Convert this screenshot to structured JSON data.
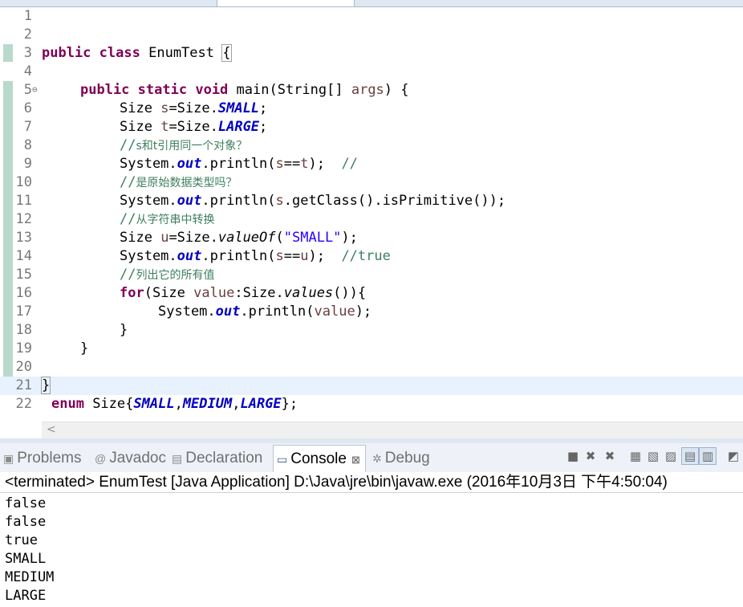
{
  "editor": {
    "line_numbers": [
      "1",
      "2",
      "3",
      "4",
      "5",
      "6",
      "7",
      "8",
      "9",
      "10",
      "11",
      "12",
      "13",
      "14",
      "15",
      "16",
      "17",
      "18",
      "19",
      "20",
      "21",
      "22"
    ],
    "lines": {
      "l3": {
        "kw1": "public",
        "kw2": "class",
        "name": "EnumTest",
        "brace": "{"
      },
      "l5": {
        "kw1": "public",
        "kw2": "static",
        "kw3": "void",
        "m": "main(String[] ",
        "p": "args",
        "end": ") {"
      },
      "l6": {
        "a": "Size ",
        "v": "s",
        "b": "=Size.",
        "f": "SMALL",
        "c": ";"
      },
      "l7": {
        "a": "Size ",
        "v": "t",
        "b": "=Size.",
        "f": "LARGE",
        "c": ";"
      },
      "l8": {
        "slash": "//",
        "t": "s和t引用同一个对象？"
      },
      "l9": {
        "a": "System.",
        "f": "out",
        "b": ".println(",
        "v1": "s",
        "c": "==",
        "v2": "t",
        "d": ");  ",
        "cm": "//"
      },
      "l10": {
        "slash": "//",
        "t": "是原始数据类型吗？"
      },
      "l11": {
        "a": "System.",
        "f": "out",
        "b": ".println(",
        "v": "s",
        "c": ".getClass().isPrimitive());"
      },
      "l12": {
        "slash": "//",
        "t": "从字符串中转换"
      },
      "l13": {
        "a": "Size ",
        "v": "u",
        "b": "=Size.",
        "m": "valueOf",
        "c": "(",
        "s": "\"SMALL\"",
        "d": ");"
      },
      "l14": {
        "a": "System.",
        "f": "out",
        "b": ".println(",
        "v1": "s",
        "c": "==",
        "v2": "u",
        "d": ");  ",
        "cm": "//true"
      },
      "l15": {
        "slash": "//",
        "t": "列出它的所有值"
      },
      "l16": {
        "kw": "for",
        "a": "(Size ",
        "v": "value",
        "b": ":Size.",
        "m": "values",
        "c": "()){"
      },
      "l17": {
        "a": "System.",
        "f": "out",
        "b": ".println(",
        "v": "value",
        "c": ");"
      },
      "l18": {
        "a": "}"
      },
      "l19": {
        "a": "}"
      },
      "l21": {
        "a": "}"
      },
      "l22": {
        "kw": "enum",
        "a": " Size{",
        "f1": "SMALL",
        "c1": ",",
        "f2": "MEDIUM",
        "c2": ",",
        "f3": "LARGE",
        "d": "};"
      }
    }
  },
  "tabs": [
    {
      "label": "Problems",
      "icon": "problems-icon"
    },
    {
      "label": "Javadoc",
      "icon": "javadoc-icon"
    },
    {
      "label": "Declaration",
      "icon": "declaration-icon"
    },
    {
      "label": "Console",
      "icon": "console-icon",
      "close": "⊠"
    },
    {
      "label": "Debug",
      "icon": "debug-icon"
    }
  ],
  "console": {
    "header": "<terminated> EnumTest [Java Application] D:\\Java\\jre\\bin\\javaw.exe (2016年10月3日 下午4:50:04)",
    "output": [
      "false",
      "false",
      "true",
      "SMALL",
      "MEDIUM",
      "LARGE"
    ]
  },
  "colors": {
    "keyword": "#7f0055",
    "field": "#0000c0",
    "comment": "#3f7f5f",
    "string": "#2a00ff"
  }
}
